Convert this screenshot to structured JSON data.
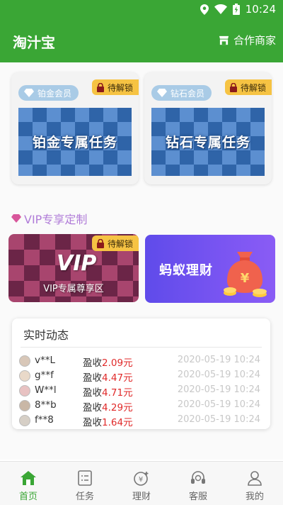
{
  "status_bar": {
    "time": "10:24"
  },
  "app_bar": {
    "title": "淘汁宝",
    "partner_label": "合作商家"
  },
  "member_cards": [
    {
      "badge": "铂金会员",
      "lock_label": "待解锁",
      "banner_title": "铂金专属任务"
    },
    {
      "badge": "钻石会员",
      "lock_label": "待解锁",
      "banner_title": "钻石专属任务"
    }
  ],
  "vip_section": {
    "heading": "VIP专享定制",
    "zone_logo": "VIP",
    "zone_caption": "VIP专属尊享区",
    "zone_lock_label": "待解锁",
    "ant_title": "蚂蚁理财"
  },
  "feed": {
    "title": "实时动态",
    "income_prefix": "盈收",
    "currency": "元",
    "rows": [
      {
        "name": "v**L",
        "amount": "2.09",
        "time": "2020-05-19 10:24"
      },
      {
        "name": "g**f",
        "amount": "4.47",
        "time": "2020-05-19 10:24"
      },
      {
        "name": "W**l",
        "amount": "4.71",
        "time": "2020-05-19 10:24"
      },
      {
        "name": "8**b",
        "amount": "4.29",
        "time": "2020-05-19 10:24"
      },
      {
        "name": "f**8",
        "amount": "1.64",
        "time": "2020-05-19 10:24"
      }
    ]
  },
  "tabs": [
    {
      "label": "首页",
      "icon": "home-icon",
      "active": true
    },
    {
      "label": "任务",
      "icon": "task-icon",
      "active": false
    },
    {
      "label": "理财",
      "icon": "finance-icon",
      "active": false
    },
    {
      "label": "客服",
      "icon": "headset-icon",
      "active": false
    },
    {
      "label": "我的",
      "icon": "user-icon",
      "active": false
    }
  ],
  "colors": {
    "brand_green": "#3aa635",
    "lock_yellow": "#f6c343",
    "amount_red": "#e02a2a",
    "vip_purple": "#b07cd8"
  }
}
